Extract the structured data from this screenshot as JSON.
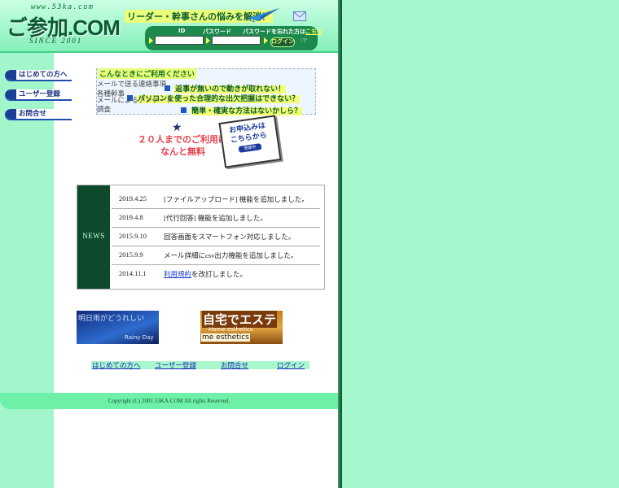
{
  "header": {
    "url": "www.53ka.com",
    "logo": "ご参加.COM",
    "since": "SINCE 2001",
    "catchphrase": "リーダー・幹事さんの悩みを解消！",
    "id_label": "ID",
    "password_label": "パスワード",
    "forgot_text": "パスワードを忘れた方は",
    "forgot_link": "こちら",
    "login_button": "ログイン",
    "colors": {
      "header_bg": "#9ff5c8",
      "login_bar": "#1d8a4d",
      "accent_yellow": "#f2ff52"
    }
  },
  "nav": {
    "items": [
      {
        "label": "はじめての方へ"
      },
      {
        "label": "ユーザー登録"
      },
      {
        "label": "お問合せ"
      }
    ]
  },
  "info": {
    "title": "こんなときにご利用ください",
    "items": [
      {
        "label": "メールで送る連絡事項",
        "link": "返事が無いので動きが取れない！"
      },
      {
        "label": "各種幹事",
        "link": "パソコンを使った合理的な出欠把握はできない？"
      },
      {
        "label": "メールによるアンケート調査",
        "link": "簡単・確実な方法はないかしら？"
      }
    ]
  },
  "promo": {
    "line1": "２０人までのご利用は",
    "line2": "なんと無料",
    "card_line1": "お申込みは",
    "card_line2": "こちらから",
    "card_button": "登録中"
  },
  "news": {
    "label": "NEWS",
    "rows": [
      {
        "date": "2019.4.25",
        "text": "[ファイルアップロード] 機能を追加しました。"
      },
      {
        "date": "2019.4.8",
        "text": "[代行回答] 機能を追加しました。"
      },
      {
        "date": "2015.9.10",
        "text": "回答画面をスマートフォン対応しました。"
      },
      {
        "date": "2015.9.9",
        "text": "メール詳細にcsv出力機能を追加しました。"
      },
      {
        "date": "2014.11.1",
        "link": "利用規約",
        "text": "を改訂しました。"
      }
    ]
  },
  "banners": {
    "rainy": {
      "title": "明日雨がどうれしい",
      "sub": "Rainy Day"
    },
    "esthe": {
      "title": "自宅でエステ",
      "sub": "Home esthetics",
      "tag": "me esthetics"
    }
  },
  "footer": {
    "links": [
      "はじめての方へ",
      "ユーザー登録",
      "お問合せ",
      "ログイン"
    ],
    "copyright": "Copyright (C) 2001 53KA.COM All rights Reserved."
  }
}
